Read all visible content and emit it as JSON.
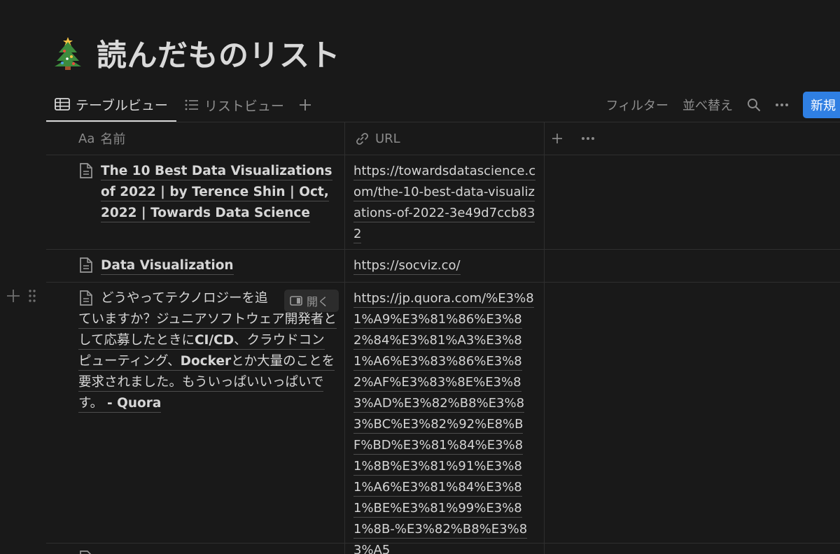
{
  "page": {
    "title": "読んだものリスト",
    "title_icon": "christmas-tree-icon"
  },
  "views": {
    "tabs": [
      {
        "label": "テーブルビュー",
        "icon": "table-icon",
        "active": true
      },
      {
        "label": "リストビュー",
        "icon": "list-icon",
        "active": false
      }
    ],
    "add_icon": "plus-icon"
  },
  "toolbar": {
    "filter_label": "フィルター",
    "sort_label": "並べ替え",
    "search_icon": "search-icon",
    "more_icon": "more-icon",
    "new_label": "新規",
    "accent": "#2f7fe3"
  },
  "table": {
    "columns": [
      {
        "label": "名前",
        "icon_text": "Aa"
      },
      {
        "label": "URL",
        "icon": "link-icon"
      }
    ],
    "rows": [
      {
        "name": "The 10 Best Data Visualizations of 2022 | by Terence Shin | Oct, 2022 | Towards Data Science",
        "url": "https://towardsdatascience.com/the-10-best-data-visualizations-of-2022-3e49d7ccb832"
      },
      {
        "name": "Data Visualization",
        "url": "https://socviz.co/"
      },
      {
        "name_line1": "どうやってテクノロジーを追",
        "name_rest": "ていますか？ジュニアソフトウェア開発者として応募したときに",
        "name_bold1": "CI/CD",
        "name_mid": "、クラウドコンピューティング、",
        "name_bold2": "Docker",
        "name_end": "とか大量のことを要求されました。もういっぱいいっぱいです。 ",
        "name_bold3": "- Quora",
        "url": "https://jp.quora.com/%E3%81%A9%E3%81%86%E3%82%84%E3%81%A3%E3%81%A6%E3%83%86%E3%82%AF%E3%83%8E%E3%83%AD%E3%82%B8%E3%83%BC%E3%82%92%E8%BF%BD%E3%81%84%E3%81%8B%E3%81%91%E3%81%A6%E3%81%84%E3%81%BE%E3%81%99%E3%81%8B-%E3%82%B8%E3%83%A5",
        "open_label": "開く"
      }
    ]
  }
}
